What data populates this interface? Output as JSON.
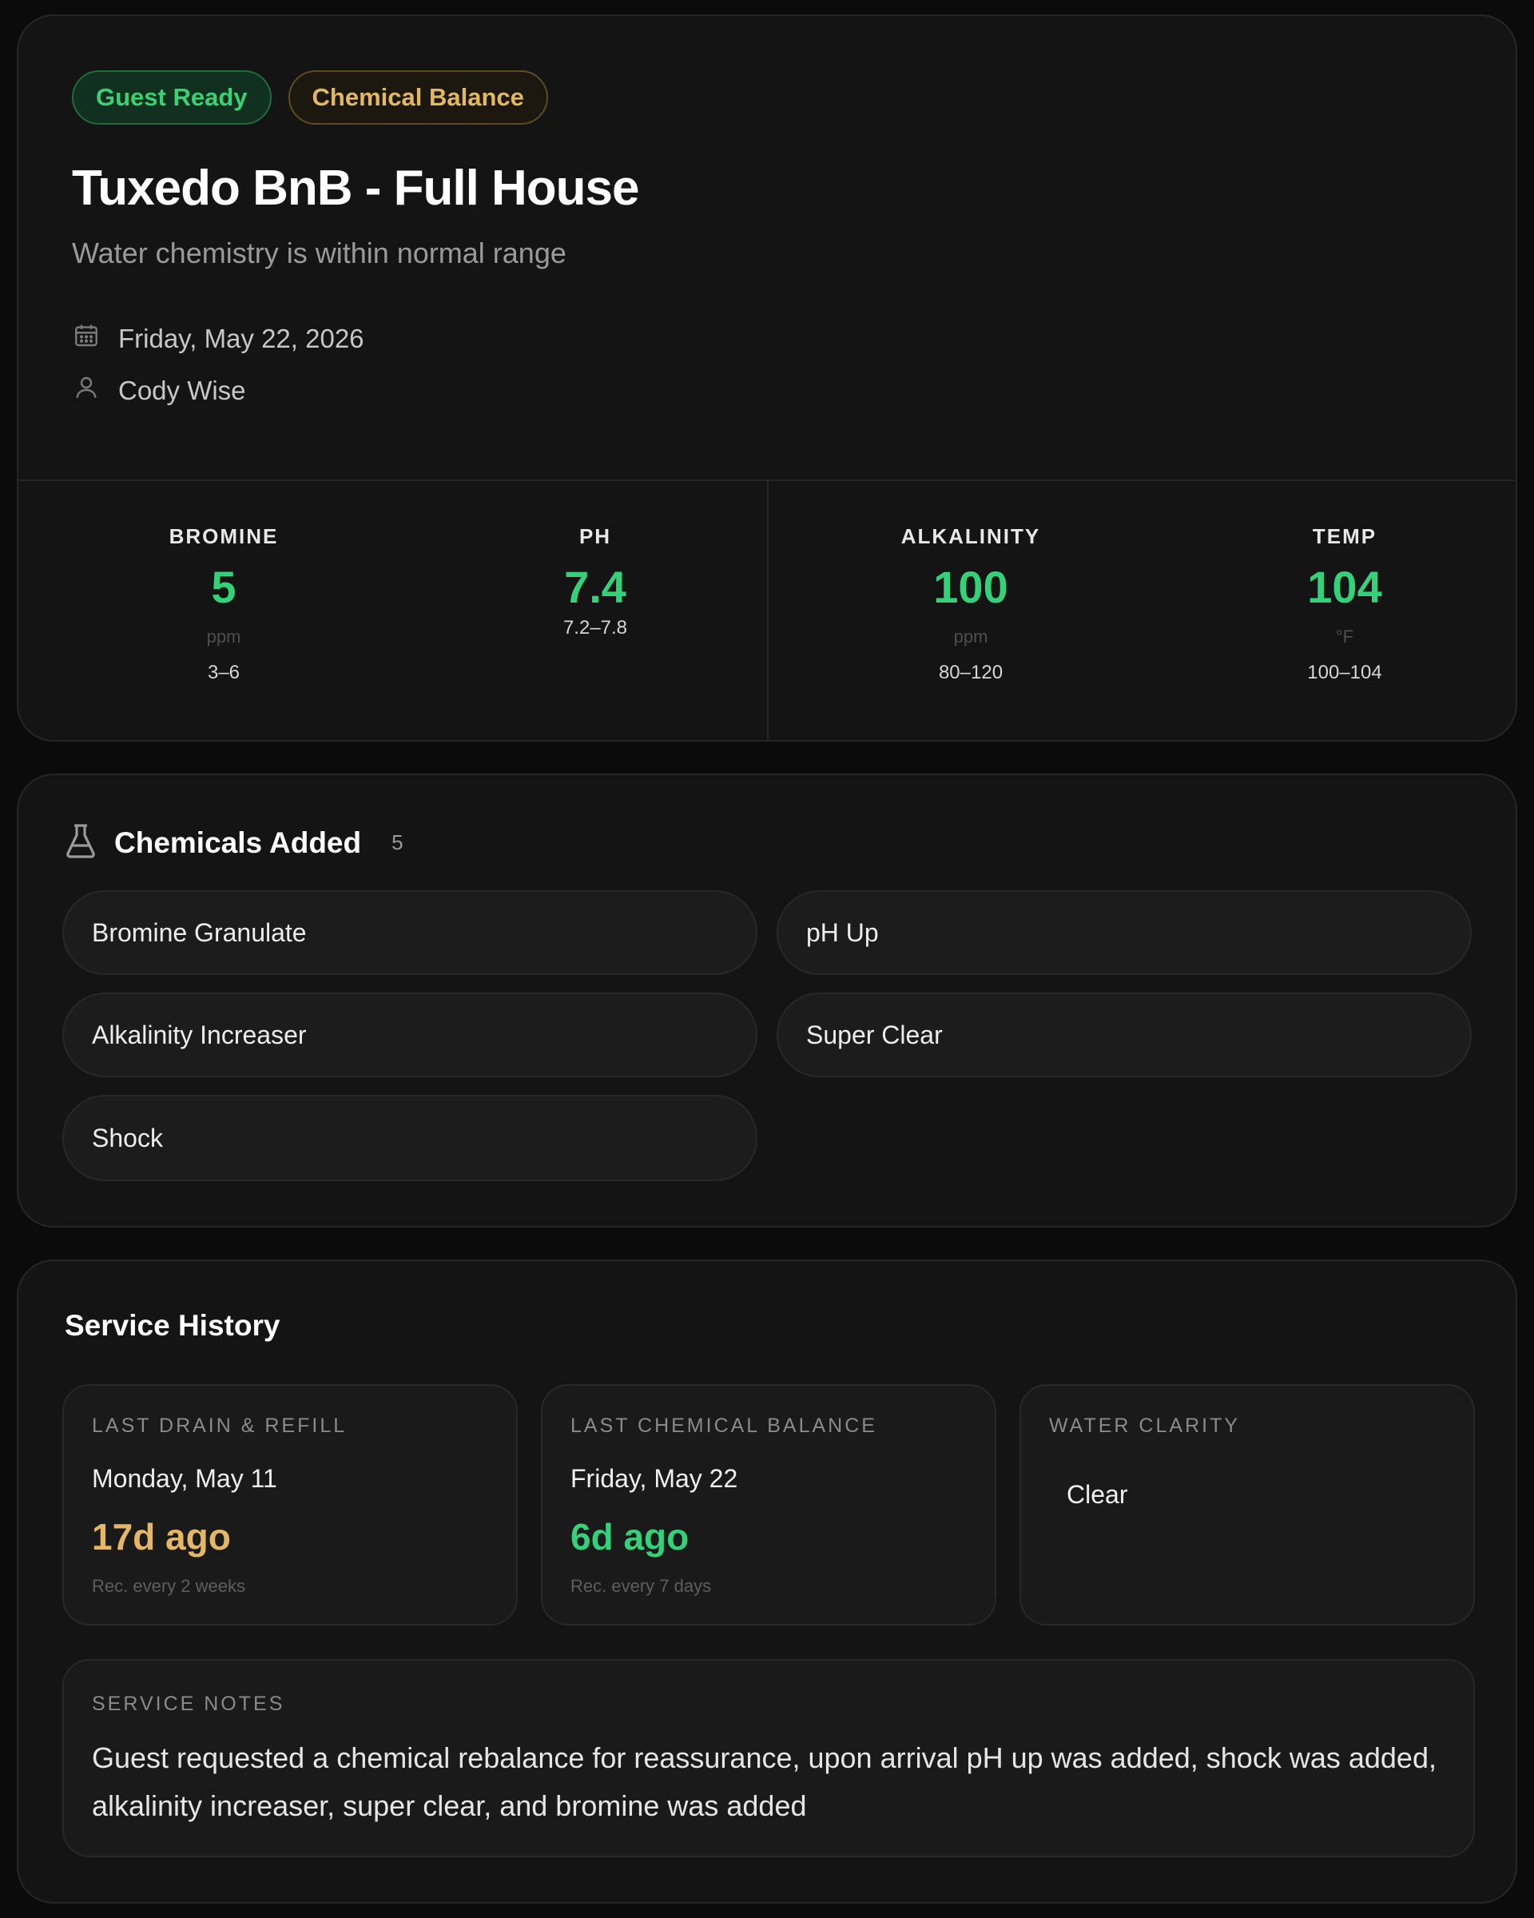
{
  "header": {
    "badges": {
      "status": "Guest Ready",
      "service_type": "Chemical Balance"
    },
    "title": "Tuxedo BnB - Full House",
    "subtitle": "Water chemistry is within normal range",
    "date": "Friday, May 22, 2026",
    "technician": "Cody Wise",
    "icons": {
      "date": "calendar-icon",
      "technician": "user-icon"
    },
    "colors": {
      "good": "#35d07a",
      "warning": "#e3b766"
    }
  },
  "metrics": [
    {
      "label": "BROMINE",
      "value": "5",
      "unit": "ppm",
      "range": "3–6"
    },
    {
      "label": "PH",
      "value": "7.4",
      "unit": "",
      "range": "7.2–7.8"
    },
    {
      "label": "ALKALINITY",
      "value": "100",
      "unit": "ppm",
      "range": "80–120"
    },
    {
      "label": "TEMP",
      "value": "104",
      "unit": "°F",
      "range": "100–104"
    }
  ],
  "chemicals": {
    "title": "Chemicals Added",
    "count": "5",
    "icon": "flask-icon",
    "items": [
      "Bromine Granulate",
      "pH Up",
      "Alkalinity Increaser",
      "Super Clear",
      "Shock"
    ]
  },
  "history": {
    "title": "Service History",
    "drain": {
      "label": "LAST DRAIN & REFILL",
      "date": "Monday, May 11",
      "ago": "17d ago",
      "rec": "Rec. every 2 weeks"
    },
    "balance": {
      "label": "LAST CHEMICAL BALANCE",
      "date": "Friday, May 22",
      "ago": "6d ago",
      "rec": "Rec. every 7 days"
    },
    "clarity": {
      "label": "WATER CLARITY",
      "value": "Clear"
    },
    "notes": {
      "label": "SERVICE NOTES",
      "text": "Guest requested a chemical rebalance for reassurance, upon arrival pH up was added, shock was added, alkalinity increaser, super clear, and bromine was added"
    }
  }
}
